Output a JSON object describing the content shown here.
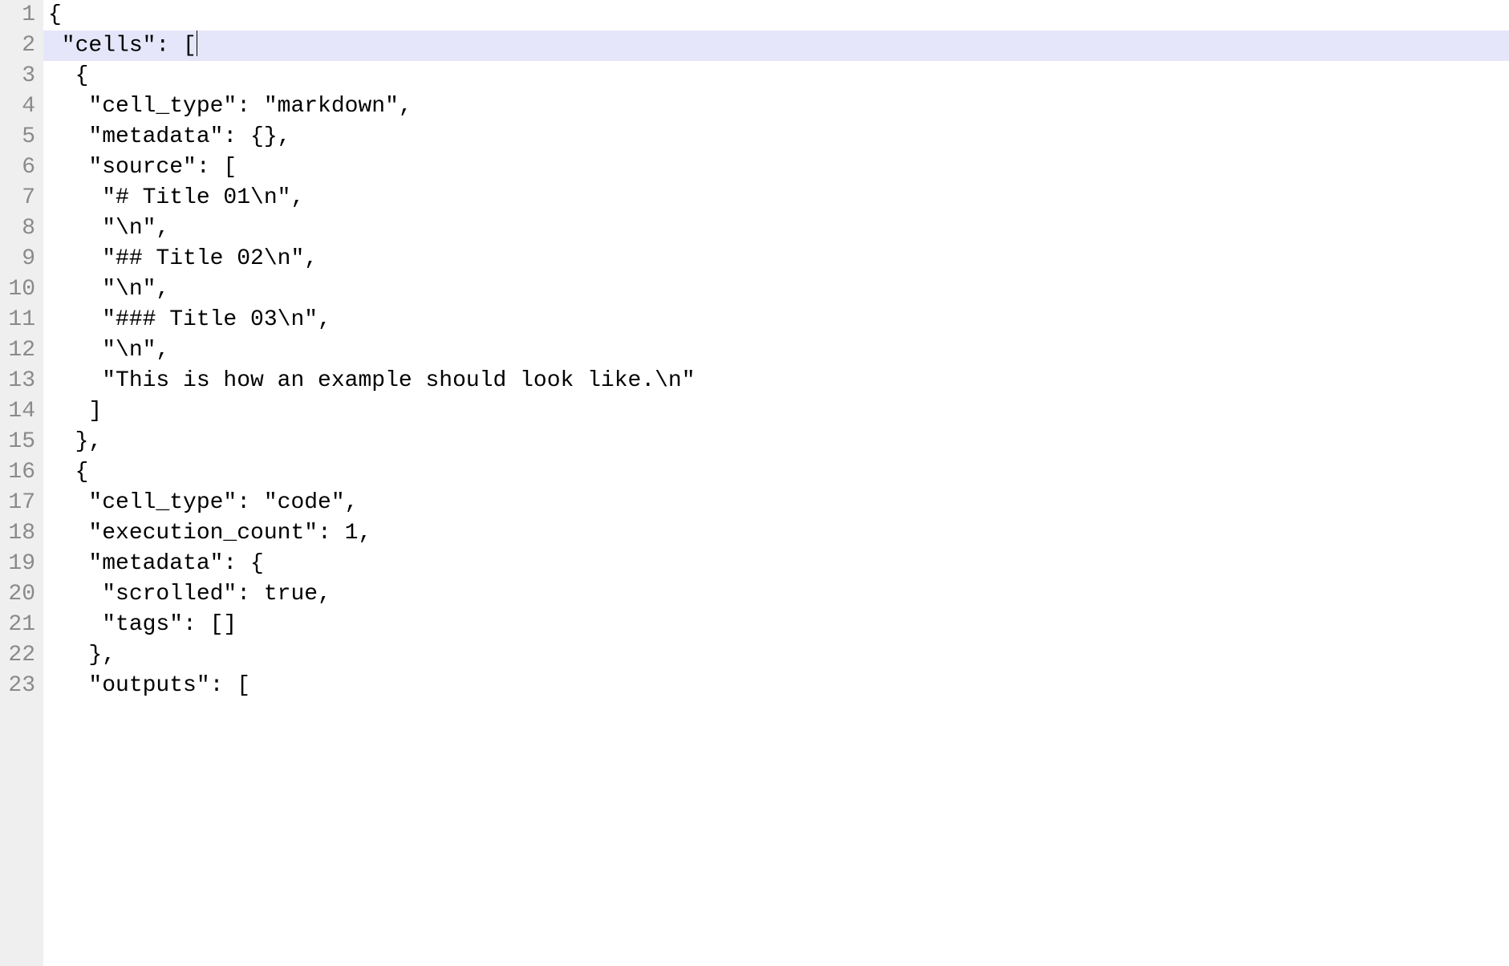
{
  "lines": [
    "{",
    " \"cells\": [",
    "  {",
    "   \"cell_type\": \"markdown\",",
    "   \"metadata\": {},",
    "   \"source\": [",
    "    \"# Title 01\\n\",",
    "    \"\\n\",",
    "    \"## Title 02\\n\",",
    "    \"\\n\",",
    "    \"### Title 03\\n\",",
    "    \"\\n\",",
    "    \"This is how an example should look like.\\n\"",
    "   ]",
    "  },",
    "  {",
    "   \"cell_type\": \"code\",",
    "   \"execution_count\": 1,",
    "   \"metadata\": {",
    "    \"scrolled\": true,",
    "    \"tags\": []",
    "   },",
    "   \"outputs\": ["
  ],
  "highlighted_line_index": 1,
  "cursor_line_index": 1,
  "cursor_col": 12,
  "bracket_match_char": "[",
  "bracket_match_col": 11,
  "line_numbers": [
    "1",
    "2",
    "3",
    "4",
    "5",
    "6",
    "7",
    "8",
    "9",
    "10",
    "11",
    "12",
    "13",
    "14",
    "15",
    "16",
    "17",
    "18",
    "19",
    "20",
    "21",
    "22",
    "23"
  ]
}
